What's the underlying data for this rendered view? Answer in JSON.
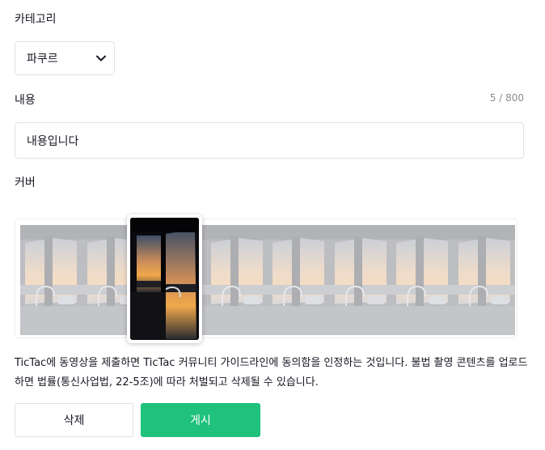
{
  "form": {
    "category": {
      "label": "카테고리",
      "selected": "파쿠르"
    },
    "content": {
      "label": "내용",
      "counter": "5 / 800",
      "value": "내용입니다"
    },
    "cover": {
      "label": "커버",
      "frame_count": 8,
      "selected_index": 1
    },
    "notice": "TicTac에 동영상을 제출하면 TicTac 커뮤니티 가이드라인에 동의함을 인정하는 것입니다. 불법 촬영 콘텐츠를 업로드하면 법률(통신사업법, 22-5조)에 따라 처벌되고 삭제될 수 있습니다.",
    "buttons": {
      "delete_label": "삭제",
      "post_label": "게시"
    }
  },
  "colors": {
    "accent": "#1fc17c",
    "border": "#e3e3e4",
    "muted_text": "#8a8b91"
  }
}
